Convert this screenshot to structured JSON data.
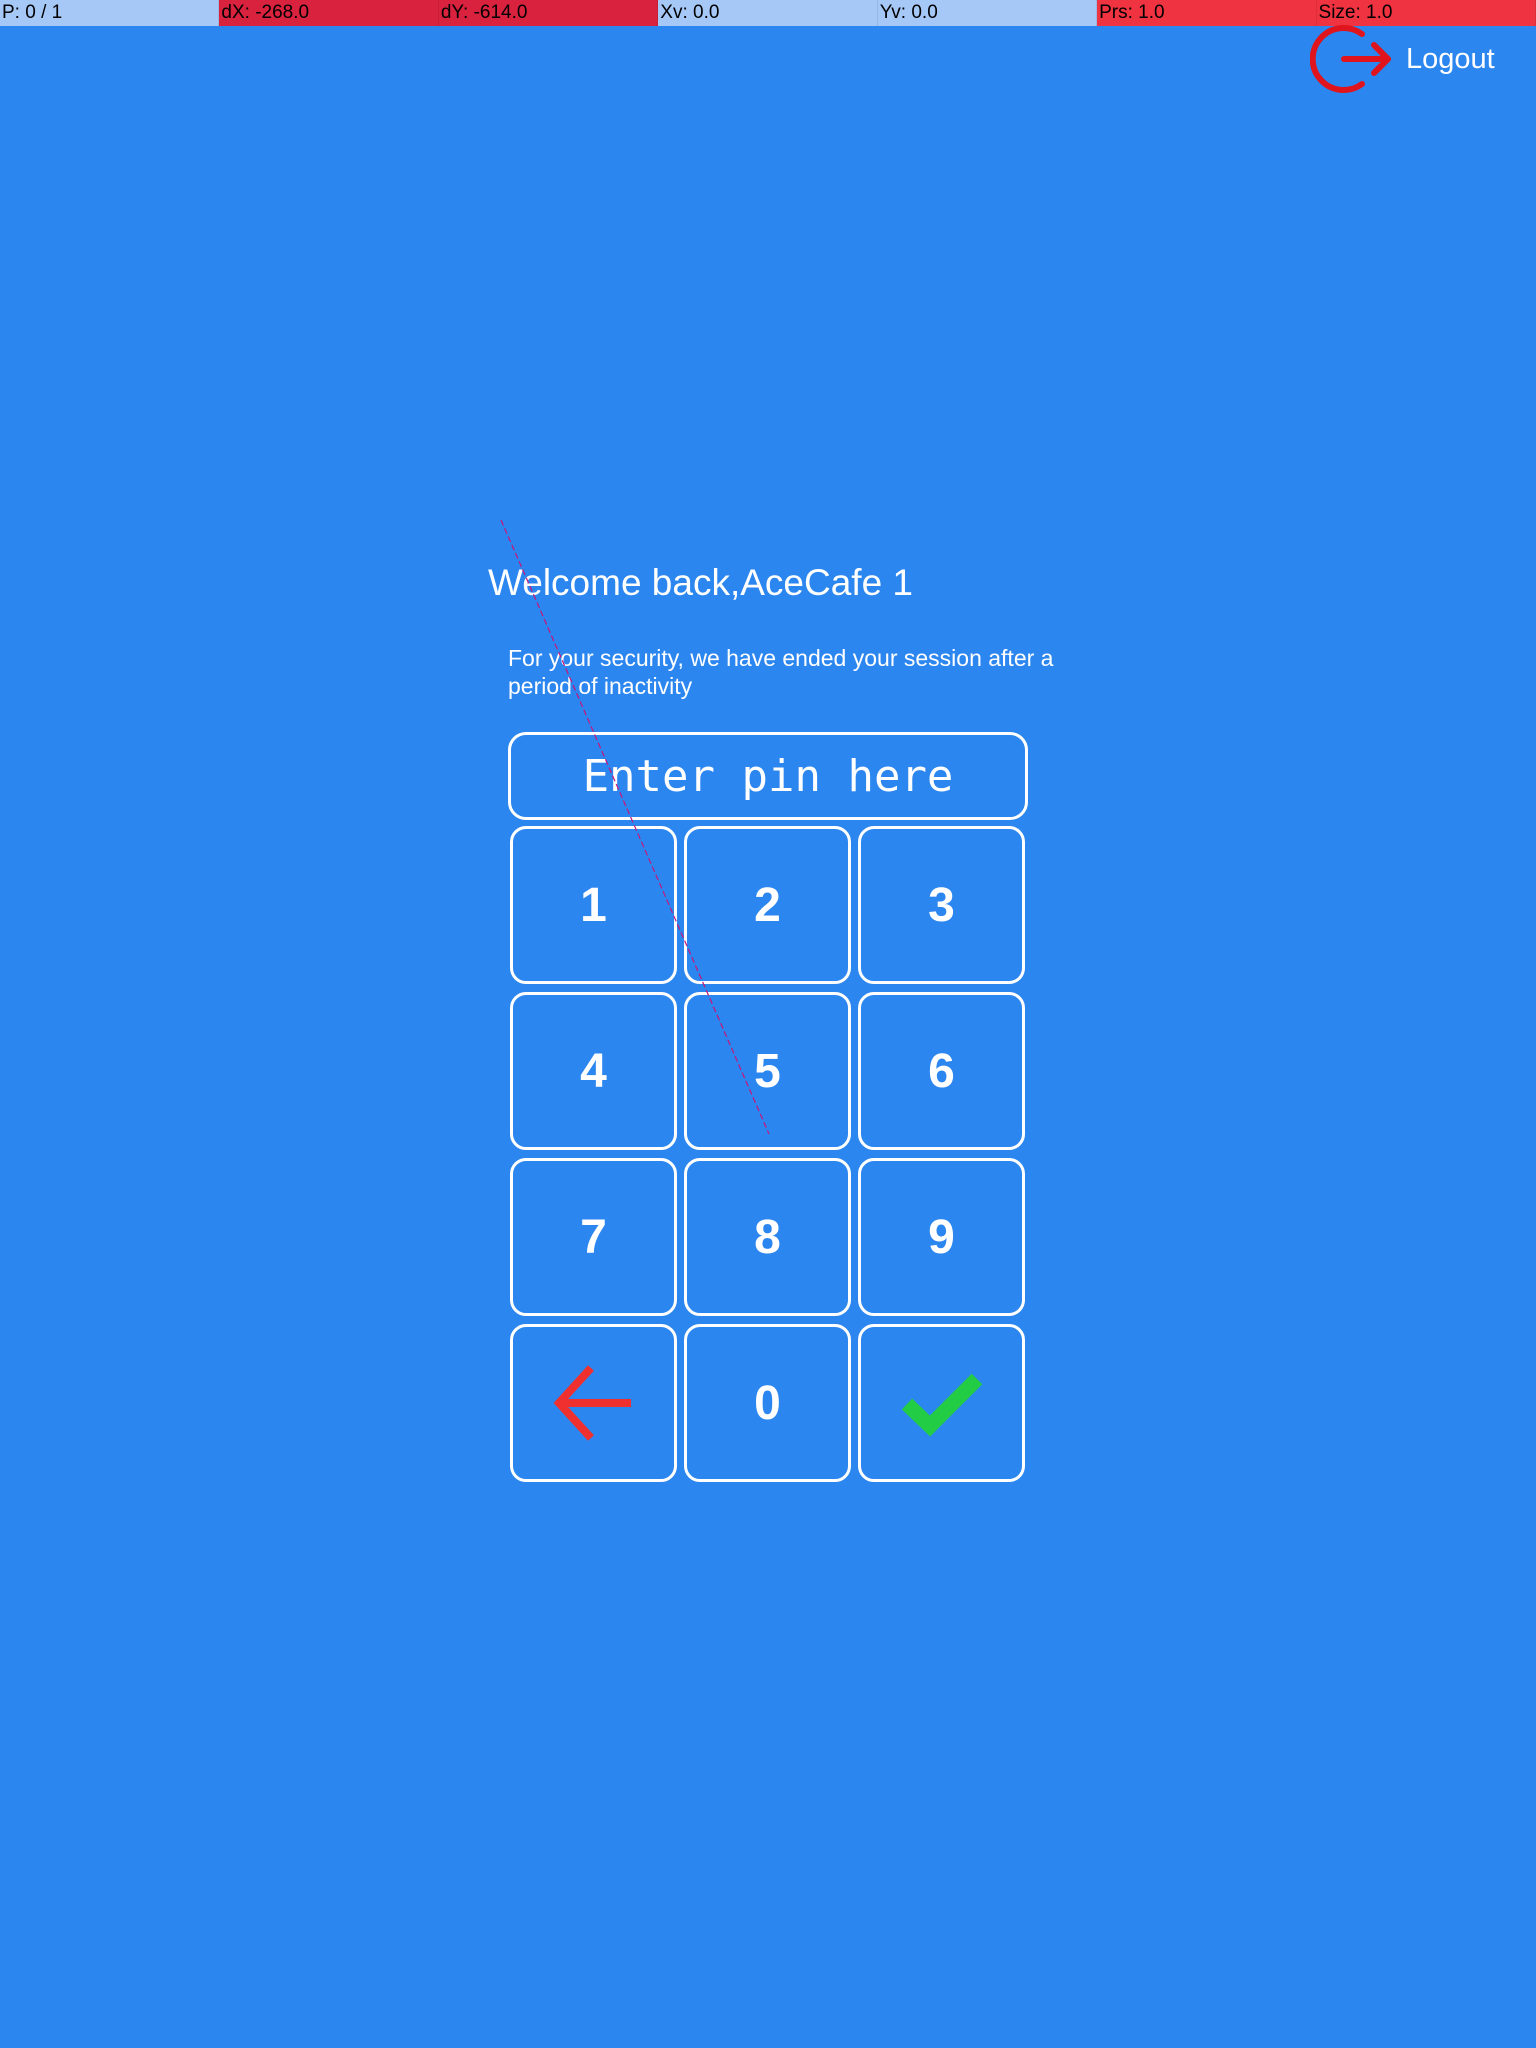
{
  "debug_bar": {
    "cells": [
      {
        "text": "P: 0 / 1",
        "bg": "#a5c8f7"
      },
      {
        "text": "dX: -268.0",
        "bg": "#d9223d"
      },
      {
        "text": "dY: -614.0",
        "bg": "#d9223d"
      },
      {
        "text": "Xv: 0.0",
        "bg": "#a5c8f7"
      },
      {
        "text": "Yv: 0.0",
        "bg": "#a5c8f7"
      },
      {
        "text": "Prs: 1.0",
        "bg": "#ef3340"
      },
      {
        "text": "Size: 1.0",
        "bg": "#ef3340"
      }
    ]
  },
  "logout": {
    "label": "Logout",
    "icon": "logout-icon",
    "icon_color": "#e0141c"
  },
  "welcome": {
    "title": "Welcome back,AceCafe 1",
    "message": "For your security, we have ended your session after a period of inactivity"
  },
  "pin": {
    "placeholder": "Enter pin here",
    "value": ""
  },
  "keypad": {
    "keys": [
      "1",
      "2",
      "3",
      "4",
      "5",
      "6",
      "7",
      "8",
      "9",
      "",
      "0",
      ""
    ],
    "backspace_icon": "arrow-left-icon",
    "backspace_color": "#f0302f",
    "confirm_icon": "checkmark-icon",
    "confirm_color": "#22cc44"
  },
  "colors": {
    "background": "#2c86f0",
    "border": "#ffffff",
    "trace": "#c4177a"
  }
}
